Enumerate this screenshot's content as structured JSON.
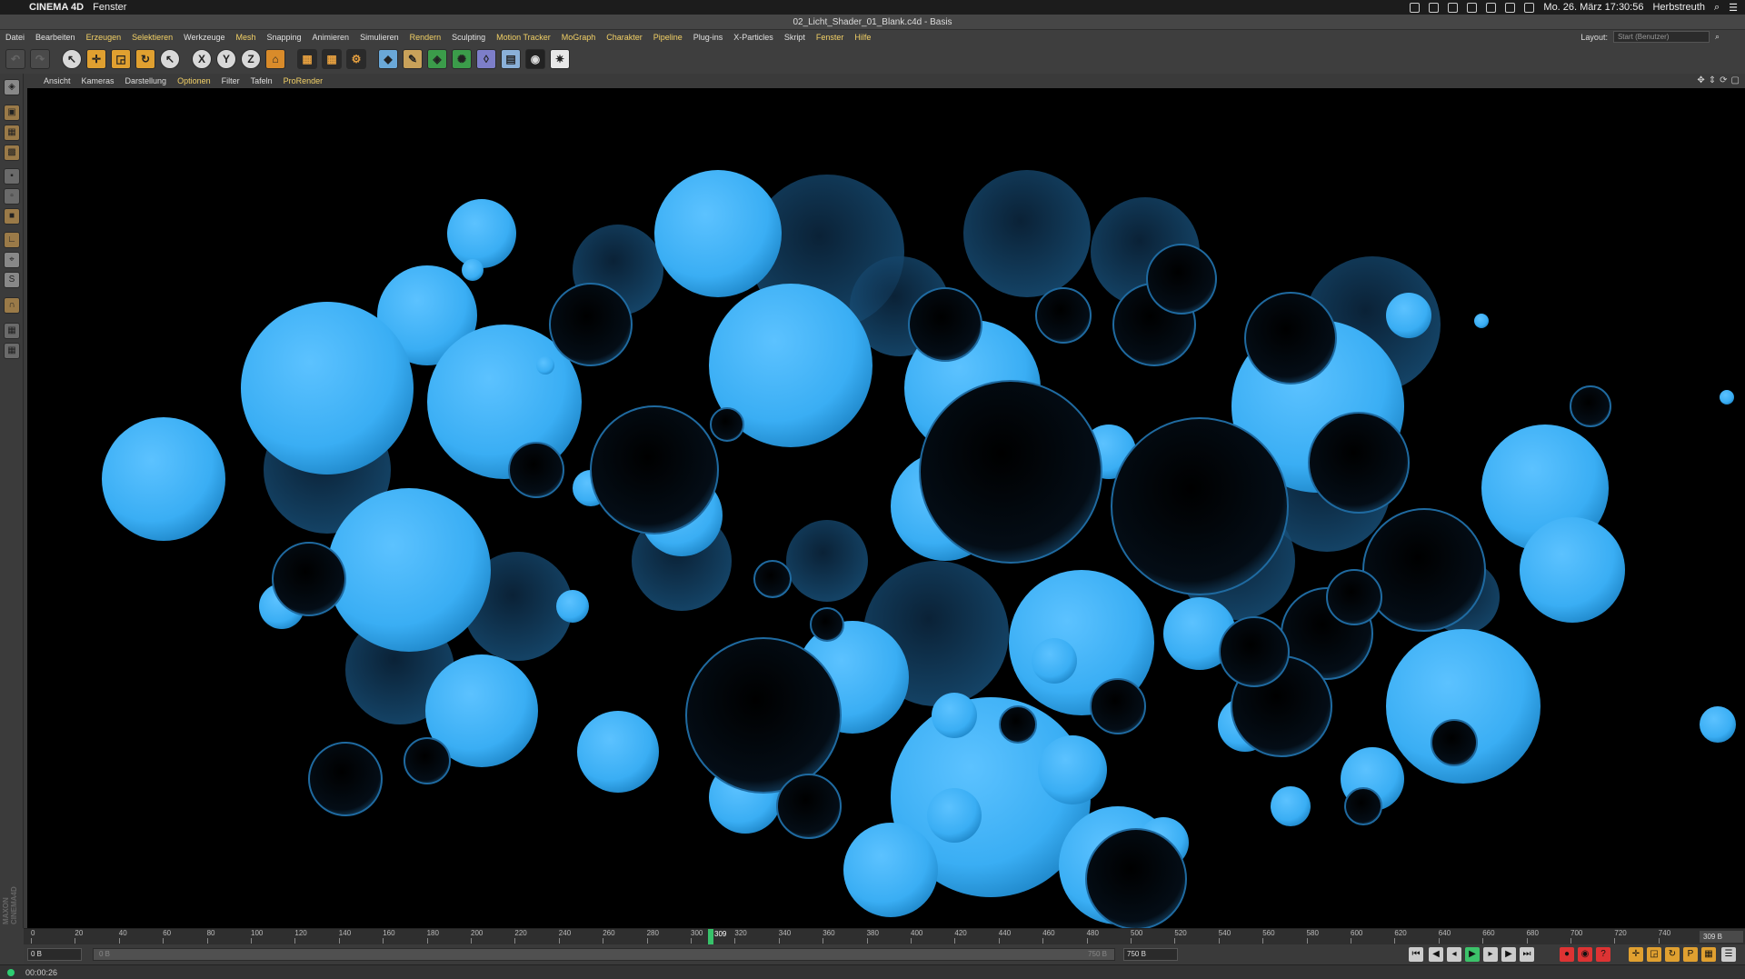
{
  "macos": {
    "app_name": "CINEMA 4D",
    "menu": "Fenster",
    "datetime": "Mo. 26. März  17:30:56",
    "user": "Herbstreuth"
  },
  "window": {
    "title": "02_Licht_Shader_01_Blank.c4d - Basis"
  },
  "main_menu": {
    "items": [
      {
        "label": "Datei",
        "hl": false
      },
      {
        "label": "Bearbeiten",
        "hl": false
      },
      {
        "label": "Erzeugen",
        "hl": true
      },
      {
        "label": "Selektieren",
        "hl": true
      },
      {
        "label": "Werkzeuge",
        "hl": false
      },
      {
        "label": "Mesh",
        "hl": true
      },
      {
        "label": "Snapping",
        "hl": false
      },
      {
        "label": "Animieren",
        "hl": false
      },
      {
        "label": "Simulieren",
        "hl": false
      },
      {
        "label": "Rendern",
        "hl": true
      },
      {
        "label": "Sculpting",
        "hl": false
      },
      {
        "label": "Motion Tracker",
        "hl": true
      },
      {
        "label": "MoGraph",
        "hl": true
      },
      {
        "label": "Charakter",
        "hl": true
      },
      {
        "label": "Pipeline",
        "hl": true
      },
      {
        "label": "Plug-ins",
        "hl": false
      },
      {
        "label": "X-Particles",
        "hl": false
      },
      {
        "label": "Skript",
        "hl": false
      },
      {
        "label": "Fenster",
        "hl": true
      },
      {
        "label": "Hilfe",
        "hl": true
      }
    ],
    "layout_label": "Layout:",
    "layout_value": "Start (Benutzer)"
  },
  "toolbar": {
    "axis_x": "X",
    "axis_y": "Y",
    "axis_z": "Z"
  },
  "viewport_menu": {
    "items": [
      {
        "label": "Ansicht",
        "hl": false
      },
      {
        "label": "Kameras",
        "hl": false
      },
      {
        "label": "Darstellung",
        "hl": false
      },
      {
        "label": "Optionen",
        "hl": true
      },
      {
        "label": "Filter",
        "hl": false
      },
      {
        "label": "Tafeln",
        "hl": false
      },
      {
        "label": "ProRender",
        "hl": true
      }
    ]
  },
  "timeline": {
    "ticks": [
      "0",
      "20",
      "40",
      "60",
      "80",
      "100",
      "120",
      "140",
      "160",
      "180",
      "200",
      "220",
      "240",
      "260",
      "280",
      "300",
      "320",
      "340",
      "360",
      "380",
      "400",
      "420",
      "440",
      "460",
      "480",
      "500",
      "520",
      "540",
      "560",
      "580",
      "600",
      "620",
      "640",
      "660",
      "680",
      "700",
      "720",
      "740"
    ],
    "current_frame": "309",
    "end_label": "309 B"
  },
  "controls": {
    "start_field": "0 B",
    "slider_left": "0 B",
    "slider_right": "750 B",
    "end_field": "750 B"
  },
  "status": {
    "time": "00:00:26"
  },
  "scene": {
    "bright_color": "#3aaef4",
    "dark_color": "#0c2a44",
    "background": "#000000"
  }
}
